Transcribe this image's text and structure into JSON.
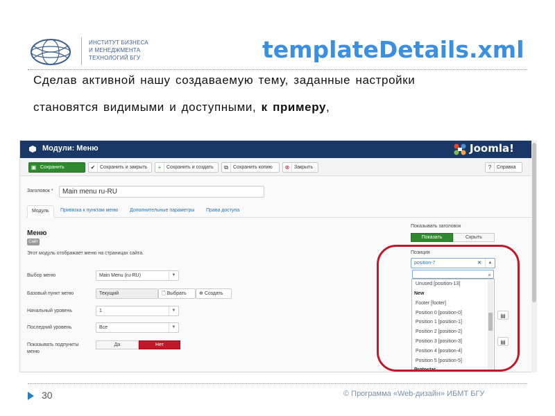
{
  "slide": {
    "logo_lines": [
      "ИНСТИТУТ БИЗНЕСА",
      "И МЕНЕДЖМЕНТА",
      "ТЕХНОЛОГИЙ БГУ"
    ],
    "title": "templateDetails.xml",
    "body_line1": "Сделав активной нашу создаваемую тему, заданные настройки",
    "body_line2_plain": "становятся видимыми и доступными, ",
    "body_line2_bold": "к примеру",
    "body_line2_tail": ",",
    "page_number": "30",
    "copyright": "© Программа «Web-дизайн» ИБМТ БГУ"
  },
  "joomla": {
    "window_title": "Модули: Меню",
    "brand": "Joomla!",
    "toolbar": {
      "save": "Сохранить",
      "save_close": "Сохранить и закрыть",
      "save_new": "Сохранить и создать",
      "save_copy": "Сохранить копию",
      "close": "Закрыть",
      "help": "Справка"
    },
    "title_label": "Заголовок *",
    "title_value": "Main menu ru-RU",
    "tabs": [
      "Модуль",
      "Привязка к пунктам меню",
      "Дополнительные параметры",
      "Права доступа"
    ],
    "section_title": "Меню",
    "site_badge": "Сайт",
    "description": "Этот модуль отображает меню на страницах сайта.",
    "fields": {
      "menu_label": "Выбор меню",
      "menu_value": "Main Menu (ru-RU)",
      "base_label": "Базовый пункт меню",
      "base_value": "Текущий",
      "base_select": "Выбрать",
      "base_create": "Создать",
      "start_label": "Начальный уровень",
      "start_value": "1",
      "end_label": "Последний уровень",
      "end_value": "Все",
      "sub_label_1": "Показывать подпункты",
      "sub_label_2": "меню",
      "yes": "Да",
      "no": "Нет"
    },
    "show_title_label": "Показывать заголовок",
    "show_btn": "Показать",
    "hide_btn": "Скрыть",
    "position_label": "Позиция",
    "position_value": "position-7",
    "dropdown": {
      "items_before": [
        "Unused [position-13]"
      ],
      "group": "New",
      "items": [
        "Footer [footer]",
        "Position 0 [position-0]",
        "Position 1 [position-1]",
        "Position 2 [position-2]",
        "Position 3 [position-3]",
        "Position 4 [position-4]",
        "Position 5 [position-5]"
      ],
      "group2": "Protostar"
    }
  },
  "colors": {
    "title_blue": "#3a8fe0",
    "joomla_bar": "#1a3867",
    "save_green": "#2f8a2f",
    "highlight_red": "#c0182a",
    "no_red": "#c0182a"
  }
}
